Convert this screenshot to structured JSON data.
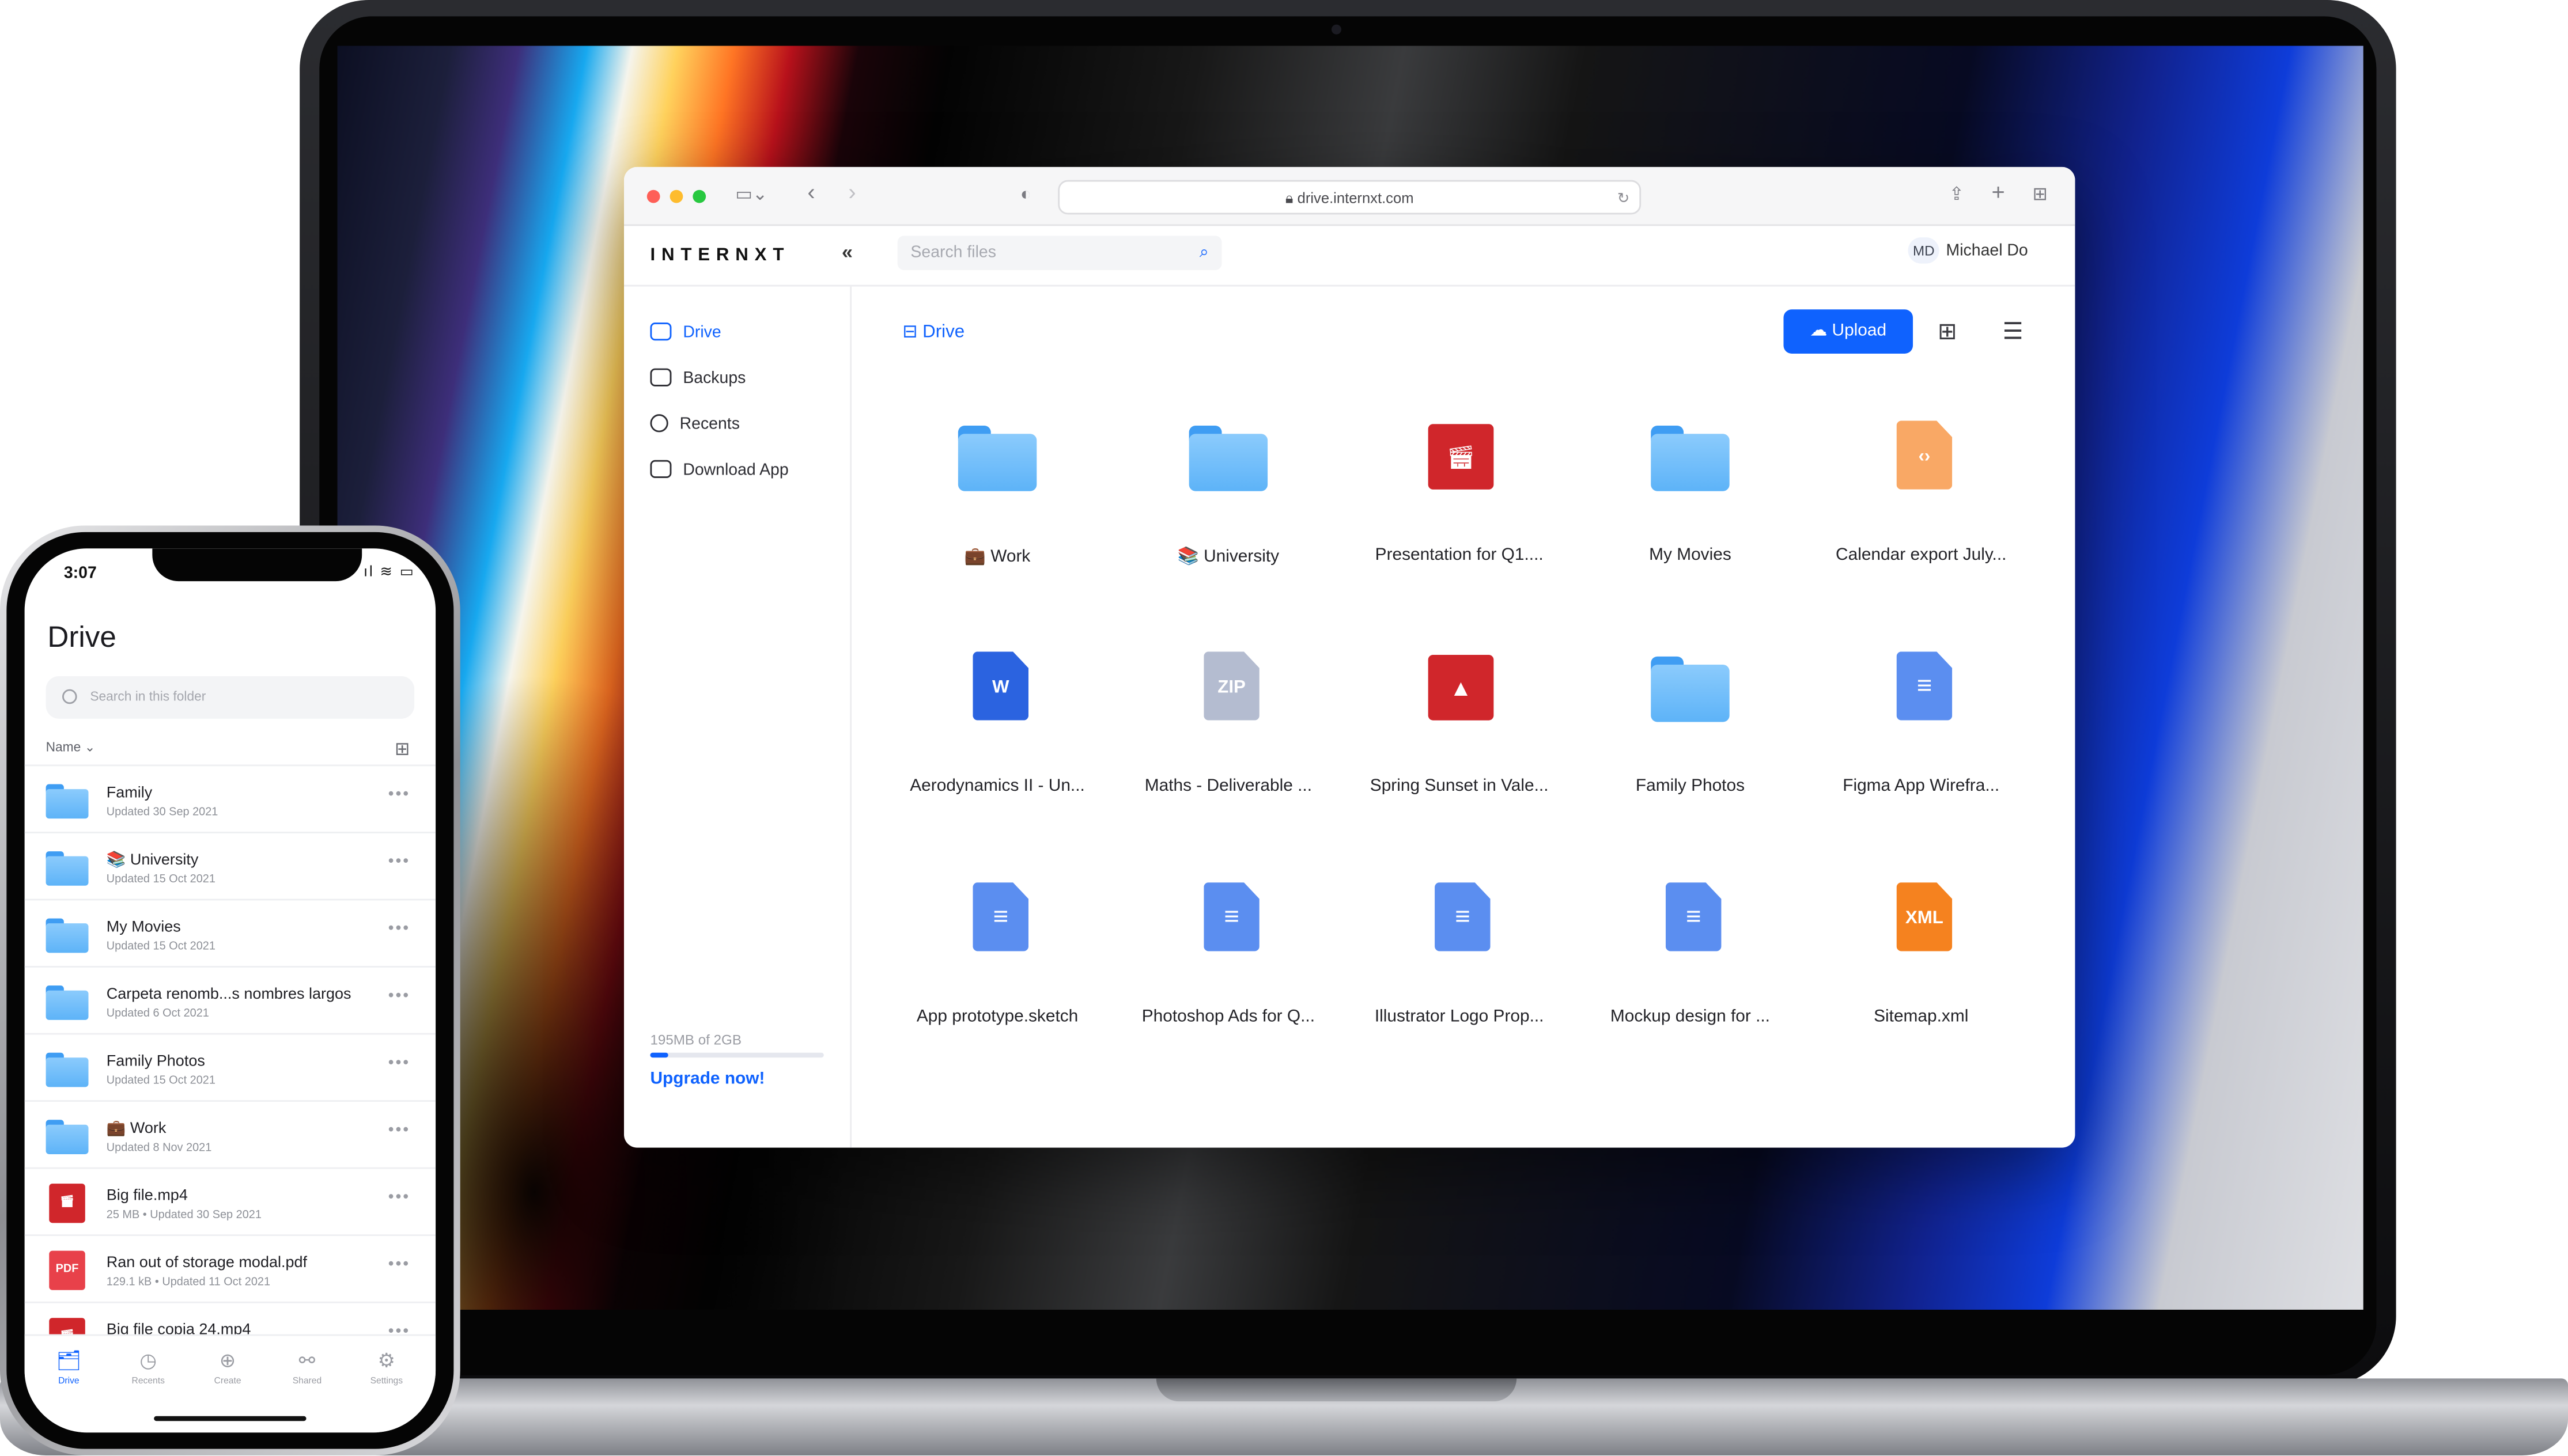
{
  "browser": {
    "url": "drive.internxt.com"
  },
  "app": {
    "logo": "INTERNXT",
    "collapse_icon": "«",
    "search_placeholder": "Search files",
    "user_initials": "MD",
    "user_name": "Michael Do",
    "sidebar": {
      "items": [
        {
          "label": "Drive",
          "icon": "drive-icon",
          "active": true
        },
        {
          "label": "Backups",
          "icon": "backups-icon",
          "active": false
        },
        {
          "label": "Recents",
          "icon": "clock-icon",
          "active": false
        },
        {
          "label": "Download App",
          "icon": "monitor-icon",
          "active": false
        }
      ],
      "usage_text": "195MB of 2GB",
      "usage_fraction": 0.1,
      "upgrade_label": "Upgrade now!"
    },
    "breadcrumb": "Drive",
    "upload_label": "Upload",
    "files": [
      {
        "name": "💼 Work",
        "type": "folder"
      },
      {
        "name": "📚 University",
        "type": "folder"
      },
      {
        "name": "Presentation for Q1....",
        "type": "video"
      },
      {
        "name": "My Movies",
        "type": "folder"
      },
      {
        "name": "Calendar export July...",
        "type": "code"
      },
      {
        "name": "Aerodynamics II - Un...",
        "type": "word",
        "badge": "W"
      },
      {
        "name": "Maths - Deliverable ...",
        "type": "zip",
        "badge": "ZIP"
      },
      {
        "name": "Spring Sunset in Vale...",
        "type": "image"
      },
      {
        "name": "Family Photos",
        "type": "folder"
      },
      {
        "name": "Figma App Wirefra...",
        "type": "doc"
      },
      {
        "name": "App prototype.sketch",
        "type": "doc"
      },
      {
        "name": "Photoshop Ads for Q...",
        "type": "doc"
      },
      {
        "name": "Illustrator Logo Prop...",
        "type": "doc"
      },
      {
        "name": "Mockup design for ...",
        "type": "doc"
      },
      {
        "name": "Sitemap.xml",
        "type": "xml",
        "badge": "XML"
      }
    ]
  },
  "phone": {
    "time": "3:07",
    "title": "Drive",
    "search_placeholder": "Search in this folder",
    "sort_label": "Name ⌄",
    "items": [
      {
        "name": "Family",
        "sub": "Updated 30 Sep 2021",
        "type": "folder"
      },
      {
        "name": "📚 University",
        "sub": "Updated 15 Oct 2021",
        "type": "folder"
      },
      {
        "name": "My Movies",
        "sub": "Updated 15 Oct 2021",
        "type": "folder"
      },
      {
        "name": "Carpeta renomb...s nombres largos",
        "sub": "Updated 6 Oct 2021",
        "type": "folder"
      },
      {
        "name": "Family Photos",
        "sub": "Updated 15 Oct 2021",
        "type": "folder"
      },
      {
        "name": "💼 Work",
        "sub": "Updated 8 Nov 2021",
        "type": "folder"
      },
      {
        "name": "Big file.mp4",
        "sub": "25 MB • Updated 30 Sep 2021",
        "type": "video"
      },
      {
        "name": "Ran out of storage modal.pdf",
        "sub": "129.1 kB • Updated 11 Oct 2021",
        "type": "pdf",
        "badge": "PDF"
      },
      {
        "name": "Big file copia 24.mp4",
        "sub": "",
        "type": "video"
      }
    ],
    "tabs": [
      {
        "label": "Drive",
        "icon": "🗂",
        "active": true
      },
      {
        "label": "Recents",
        "icon": "◷",
        "active": false
      },
      {
        "label": "Create",
        "icon": "⊕",
        "active": false
      },
      {
        "label": "Shared",
        "icon": "⚯",
        "active": false
      },
      {
        "label": "Settings",
        "icon": "⚙",
        "active": false
      }
    ]
  },
  "colors": {
    "accent": "#0f62fe",
    "folder": "#5db3f8",
    "video": "#d0262b",
    "code": "#f9a865",
    "word": "#2b63e0",
    "zip": "#b4bcd0",
    "doc": "#5b8ef0",
    "xml": "#f5821f",
    "pdf": "#e8414a"
  }
}
